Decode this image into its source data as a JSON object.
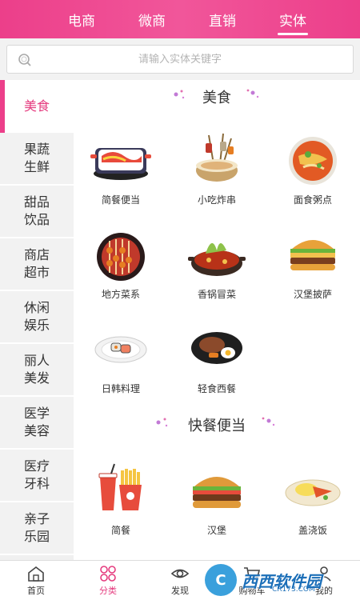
{
  "top_tabs": [
    "电商",
    "微商",
    "直销",
    "实体"
  ],
  "active_tab_index": 3,
  "search": {
    "placeholder": "请输入实体关键字"
  },
  "sidebar": [
    {
      "label": "美食",
      "active": true
    },
    {
      "label": "果蔬生鲜"
    },
    {
      "label": "甜品饮品"
    },
    {
      "label": "商店超市"
    },
    {
      "label": "休闲娱乐"
    },
    {
      "label": "丽人美发"
    },
    {
      "label": "医学美容"
    },
    {
      "label": "医疗牙科"
    },
    {
      "label": "亲子乐园"
    }
  ],
  "sections": [
    {
      "title": "美食",
      "items": [
        {
          "label": "简餐便当",
          "icon": "bento-box-icon"
        },
        {
          "label": "小吃炸串",
          "icon": "skewer-pot-icon"
        },
        {
          "label": "面食粥点",
          "icon": "noodle-bowl-icon"
        },
        {
          "label": "地方菜系",
          "icon": "grill-skewers-icon"
        },
        {
          "label": "香锅冒菜",
          "icon": "spicy-pot-icon"
        },
        {
          "label": "汉堡披萨",
          "icon": "burger-icon"
        },
        {
          "label": "日韩料理",
          "icon": "sushi-plate-icon"
        },
        {
          "label": "轻食西餐",
          "icon": "steak-plate-icon"
        }
      ]
    },
    {
      "title": "快餐便当",
      "items": [
        {
          "label": "简餐",
          "icon": "fries-drink-icon"
        },
        {
          "label": "汉堡",
          "icon": "hamburger-icon"
        },
        {
          "label": "盖浇饭",
          "icon": "rice-plate-icon"
        }
      ]
    }
  ],
  "bottom_nav": [
    {
      "label": "首页",
      "icon": "home-icon"
    },
    {
      "label": "分类",
      "icon": "category-icon",
      "active": true
    },
    {
      "label": "发现",
      "icon": "eye-icon"
    },
    {
      "label": "购物车",
      "icon": "cart-icon"
    },
    {
      "label": "我的",
      "icon": "user-icon"
    }
  ],
  "watermark": {
    "badge": "C",
    "text": "西西软件园",
    "sub": "CR173.COM"
  },
  "colors": {
    "accent": "#ec3f8a",
    "accent_text": "#e53c7f"
  }
}
